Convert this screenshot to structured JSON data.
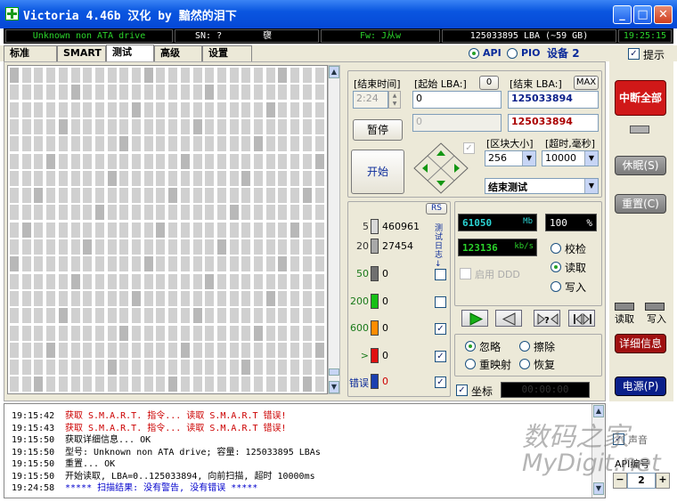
{
  "window": {
    "title": "Victoria 4.46b 汉化 by 黯然的泪下"
  },
  "infobar": {
    "drive": "Unknown non ATA drive",
    "sn": "SN: ?",
    "sn_glyph": "襃",
    "fw": "Fw: J从w",
    "lba": "125033895 LBA (~59 GB)",
    "clock": "19:25:15"
  },
  "tabs": [
    "标准",
    "SMART",
    "测试",
    "高级",
    "设置"
  ],
  "mode": {
    "api": "API",
    "pio": "PIO",
    "device_label": "设备",
    "device_num": "2",
    "hint": "提示"
  },
  "test": {
    "end_time_label": "[结束时间]",
    "end_time_value": "2:24",
    "start_lba_label": "[起始 LBA:]",
    "start_lba_zero_btn": "0",
    "start_lba_value": "0",
    "end_lba_label": "[结束 LBA:]",
    "max_btn": "MAX",
    "end_lba_value": "125033894",
    "progress_value": "0",
    "end_lba_value2": "125033894",
    "pause_btn": "暂停",
    "start_btn": "开始",
    "block_size_label": "[区块大小]",
    "timeout_label": "[超时,毫秒]",
    "block_size": "256",
    "timeout": "10000",
    "end_test": "结束测试"
  },
  "stats": {
    "rs": "RS",
    "vertical_label": "测试日志 ↓",
    "rows": [
      {
        "ms": "5",
        "count": "460961",
        "color": "#d8d8d8"
      },
      {
        "ms": "20",
        "count": "27454",
        "color": "#a8a8a8"
      },
      {
        "ms": "50",
        "count": "0",
        "color": "#707070"
      },
      {
        "ms": "200",
        "count": "0",
        "color": "#16c016"
      },
      {
        "ms": "600",
        "count": "0",
        "color": "#ff8c00"
      },
      {
        "ms": ">",
        "count": "0",
        "color": "#e01010"
      },
      {
        "ms": "错误",
        "count": "0",
        "color": "#1a3fb0"
      }
    ]
  },
  "readout": {
    "mb": "61050",
    "mb_unit": "Mb",
    "pct": "100",
    "pct_unit": "%",
    "speed": "123136",
    "speed_unit": "kb/s",
    "ddd": "启用 DDD",
    "verify": "校检",
    "read": "读取",
    "write": "写入"
  },
  "actions": {
    "ignore": "忽略",
    "erase": "擦除",
    "remap": "重映射",
    "restore": "恢复"
  },
  "coord": {
    "label": "坐标",
    "value": "00:00:00"
  },
  "right": {
    "stop_all": "中断全部",
    "sleep": "休眠(S)",
    "reset": "重置(C)",
    "read": "读取",
    "write": "写入",
    "details": "详细信息",
    "power": "电源(P)",
    "sound": "声音",
    "api_num_label": "API编号",
    "api_num": "2"
  },
  "log": [
    {
      "time": "19:15:42",
      "text": "获取 S.M.A.R.T. 指令... 读取 S.M.A.R.T 错误!",
      "color": "#cc0000"
    },
    {
      "time": "19:15:43",
      "text": "获取 S.M.A.R.T. 指令... 读取 S.M.A.R.T 错误!",
      "color": "#cc0000"
    },
    {
      "time": "19:15:50",
      "text": "获取详细信息... OK",
      "color": "#000000"
    },
    {
      "time": "19:15:50",
      "text": "型号:  Unknown non ATA drive;      容量: 125033895 LBAs",
      "color": "#000000"
    },
    {
      "time": "19:15:50",
      "text": "重置... OK",
      "color": "#000000"
    },
    {
      "time": "19:15:50",
      "text": "开始读取, LBA=0..125033894, 向前扫描, 超时 10000ms",
      "color": "#000000"
    },
    {
      "time": "19:24:58",
      "text": "***** 扫描结果: 没有警告, 没有错误 *****",
      "color": "#0000cc"
    }
  ],
  "watermark": {
    "line1": "数码之家",
    "line2": "MyDigit.net"
  },
  "colors": {
    "stop_all_bg": "#d01818",
    "details_bg": "#a01010",
    "power_bg": "#0a1f8a"
  }
}
